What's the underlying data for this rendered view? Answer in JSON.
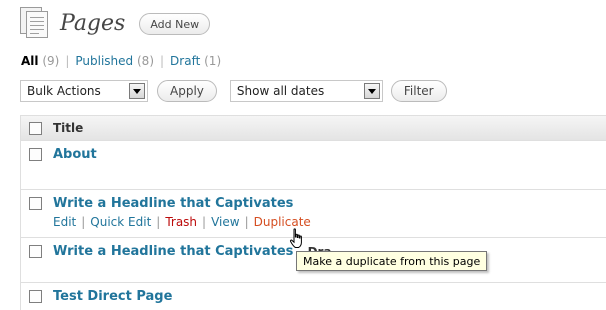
{
  "header": {
    "title": "Pages",
    "add_new": "Add New"
  },
  "filters": {
    "items": [
      {
        "label": "All",
        "count": "(9)"
      },
      {
        "label": "Published",
        "count": "(8)"
      },
      {
        "label": "Draft",
        "count": "(1)"
      }
    ]
  },
  "toolbar": {
    "bulk_actions": "Bulk Actions",
    "apply": "Apply",
    "dates": "Show all dates",
    "filter": "Filter"
  },
  "table": {
    "column_title": "Title",
    "rows": [
      {
        "title": "About"
      },
      {
        "title": "Write a Headline that Captivates"
      },
      {
        "title": "Write a Headline that Captivates",
        "suffix": "- Dra"
      },
      {
        "title": "Test Direct Page"
      }
    ],
    "row_actions": {
      "edit": "Edit",
      "quick_edit": "Quick Edit",
      "trash": "Trash",
      "view": "View",
      "duplicate": "Duplicate"
    }
  },
  "tooltip": "Make a duplicate from this page",
  "icons": [
    "pages-icon",
    "dropdown-arrow-icon",
    "hand-cursor-icon"
  ],
  "colors": {
    "link": "#21759b",
    "trash": "#bc0b0b",
    "duplicate": "#d54e21",
    "tooltip_bg": "#ffffe1"
  }
}
